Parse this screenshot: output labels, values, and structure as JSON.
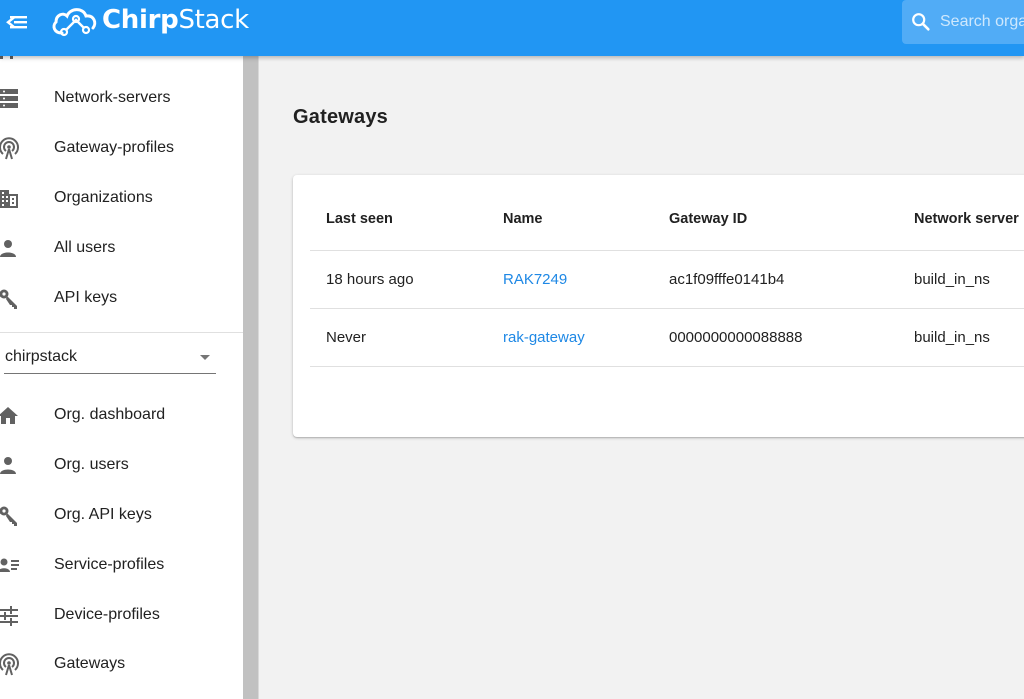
{
  "app": {
    "brand_bold": "Chirp",
    "brand_light": "Stack",
    "search_placeholder": "Search organization"
  },
  "colors": {
    "appbar": "#2196f3",
    "link": "#1e88e5"
  },
  "sidebar": {
    "admin_items": [
      {
        "label": "Network-servers",
        "icon": "server-icon"
      },
      {
        "label": "Gateway-profiles",
        "icon": "gateway-icon"
      },
      {
        "label": "Organizations",
        "icon": "domain-icon"
      },
      {
        "label": "All users",
        "icon": "user-icon"
      },
      {
        "label": "API keys",
        "icon": "key-icon"
      }
    ],
    "organization_selected": "chirpstack",
    "org_items": [
      {
        "label": "Org. dashboard",
        "icon": "home-icon"
      },
      {
        "label": "Org. users",
        "icon": "user-icon"
      },
      {
        "label": "Org. API keys",
        "icon": "key-icon"
      },
      {
        "label": "Service-profiles",
        "icon": "account-details-icon"
      },
      {
        "label": "Device-profiles",
        "icon": "tune-icon"
      },
      {
        "label": "Gateways",
        "icon": "gateway-icon"
      }
    ]
  },
  "main": {
    "title": "Gateways",
    "table": {
      "headers": [
        "Last seen",
        "Name",
        "Gateway ID",
        "Network server"
      ],
      "rows": [
        {
          "last_seen": "18 hours ago",
          "name": "RAK7249",
          "gateway_id": "ac1f09fffe0141b4",
          "network_server": "build_in_ns"
        },
        {
          "last_seen": "Never",
          "name": "rak-gateway",
          "gateway_id": "0000000000088888",
          "network_server": "build_in_ns"
        }
      ]
    }
  }
}
